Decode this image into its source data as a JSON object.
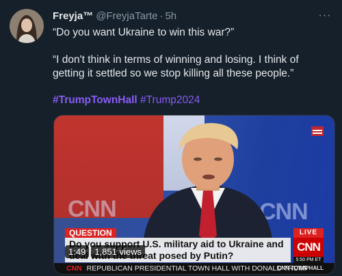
{
  "tweet": {
    "author_name": "Freyja™",
    "handle": "@FreyjaTarte",
    "separator": "·",
    "time": "5h",
    "more": "···",
    "paragraph_1": "“Do you want Ukraine to win this war?”",
    "paragraph_2": "“I don't think in terms of winning and losing. I think of getting it settled so we stop killing all these people.”",
    "hashtag_1": "#TrumpTownHall",
    "hashtag_2": "#Trump2024"
  },
  "video": {
    "question_label": "QUESTION",
    "question_text": "Do you support U.S. military aid to Ukraine and deal with the threat posed by Putin?",
    "live_label": "LIVE",
    "network_logo": "CNN",
    "clock": "5:50 PM ET",
    "ticker_network": "CNN",
    "ticker_text": "REPUBLICAN PRESIDENTIAL TOWN HALL WITH DONALD TRUMP",
    "ticker_right": "CNN TOWN HALL",
    "duration": "1:49",
    "views": "1,851 views",
    "wall_text": "CNN"
  },
  "colors": {
    "background": "#15202b",
    "hashtag": "#8b5cf6",
    "cnn_red": "#cc0000"
  }
}
